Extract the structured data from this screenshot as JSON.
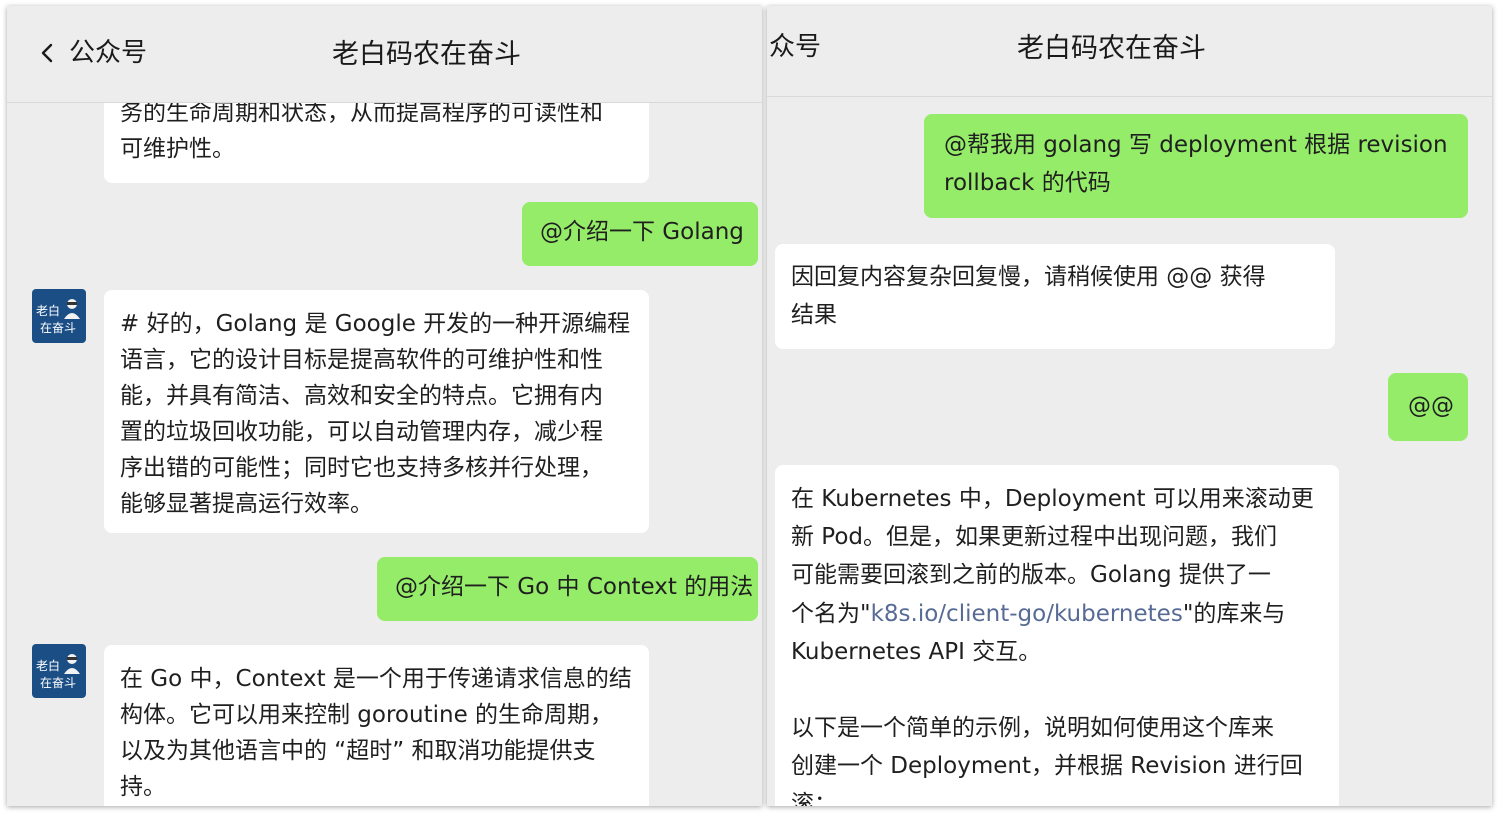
{
  "colors": {
    "background": "#ededed",
    "incoming_bubble": "#ffffff",
    "outgoing_bubble": "#95ec69",
    "avatar": "#1c4e86",
    "link": "#576b95"
  },
  "left_panel": {
    "header": {
      "back_icon": "chevron-left-icon",
      "back_label": "公众号",
      "title": "老白码农在奋斗"
    },
    "avatar": {
      "line1": "老白",
      "line2": "在奋斗"
    },
    "messages": [
      {
        "side": "incoming",
        "lines": [
          "务的生命周期和状态，从而提高程序的可读性和",
          "可维护性。"
        ]
      },
      {
        "side": "outgoing",
        "text": "@介绍一下 Golang"
      },
      {
        "side": "incoming",
        "lines": [
          "# 好的，Golang 是 Google 开发的一种开源编程",
          "语言，它的设计目标是提高软件的可维护性和性",
          "能，并具有简洁、高效和安全的特点。它拥有内",
          "置的垃圾回收功能，可以自动管理内存，减少程",
          "序出错的可能性；同时它也支持多核并行处理，",
          "能够显著提高运行效率。"
        ]
      },
      {
        "side": "outgoing",
        "text": "@介绍一下 Go 中 Context 的用法"
      },
      {
        "side": "incoming",
        "lines": [
          "在 Go 中，Context 是一个用于传递请求信息的结",
          "构体。它可以用来控制 goroutine 的生命周期，",
          "以及为其他语言中的 “超时” 和取消功能提供支",
          "持。"
        ]
      }
    ]
  },
  "right_panel": {
    "header": {
      "back_label_partial": "众号",
      "title": "老白码农在奋斗"
    },
    "messages": [
      {
        "side": "outgoing",
        "lines": [
          "@帮我用 golang 写 deployment 根据 revision",
          "rollback 的代码"
        ]
      },
      {
        "side": "incoming",
        "lines": [
          "因回复内容复杂回复慢，请稍候使用 @@ 获得",
          "结果"
        ]
      },
      {
        "side": "outgoing",
        "text": "@@"
      },
      {
        "side": "incoming",
        "line1": "在 Kubernetes 中，Deployment 可以用来滚动更",
        "line2": "新 Pod。但是，如果更新过程中出现问题，我们",
        "line3": "可能需要回滚到之前的版本。Golang 提供了一",
        "line4_before": "个名为\"",
        "line4_link": "k8s.io/client-go/kubernetes",
        "line4_after": "\"的库来与",
        "line5": "Kubernetes API 交互。",
        "line6": "以下是一个简单的示例，说明如何使用这个库来",
        "line7": "创建一个 Deployment，并根据 Revision 进行回",
        "line8": "滚："
      }
    ]
  }
}
